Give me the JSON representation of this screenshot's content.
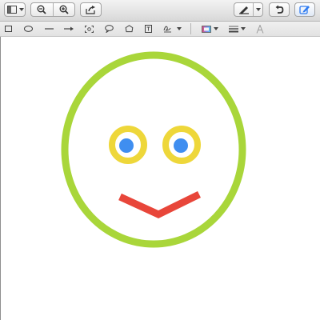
{
  "toolbar": {
    "icons": [
      "sidebar-view-icon",
      "zoom-out-icon",
      "zoom-in-icon",
      "share-icon",
      "pen-markup-icon",
      "rotate-icon",
      "markup-toolbar-icon"
    ],
    "markup_active": true,
    "accent_color": "#2f7bf0"
  },
  "markup_bar": {
    "tools": [
      "rectangle-shape",
      "oval-shape",
      "line-shape",
      "arrow-shape",
      "selection-loupe",
      "speech-bubble",
      "star-shape",
      "text-box",
      "signature",
      "border-color",
      "line-style",
      "text-style"
    ]
  },
  "drawing": {
    "face_outline_color": "#a9d63a",
    "eye_ring_color": "#eed73a",
    "pupil_color": "#3f8ef0",
    "mouth_color": "#e8463a"
  }
}
